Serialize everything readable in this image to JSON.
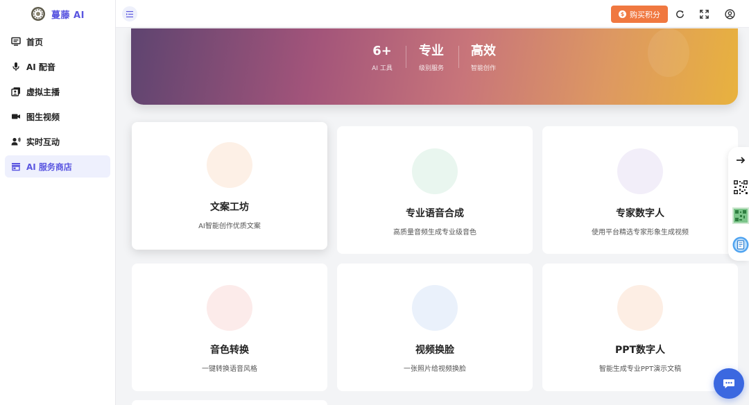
{
  "brand": {
    "name": "蔓藤 AI"
  },
  "sidebar": {
    "items": [
      {
        "label": "首页",
        "icon": "monitor-icon"
      },
      {
        "label": "AI 配音",
        "icon": "microphone-icon"
      },
      {
        "label": "虚拟主播",
        "icon": "gallery-icon"
      },
      {
        "label": "图生视频",
        "icon": "video-camera-icon"
      },
      {
        "label": "实时互动",
        "icon": "user-voice-icon"
      },
      {
        "label": "AI 服务商店",
        "icon": "store-icon"
      }
    ],
    "active_index": 5
  },
  "header": {
    "buy_label": "购买积分",
    "buy_color": "#f07840"
  },
  "banner": {
    "stats": [
      {
        "value": "6+",
        "label": "AI 工具"
      },
      {
        "value": "专业",
        "label": "级别服务"
      },
      {
        "value": "高效",
        "label": "智能创作"
      }
    ]
  },
  "cards": [
    {
      "title": "文案工坊",
      "desc": "AI智能创作优质文案",
      "circle_color": "#fdf0e6"
    },
    {
      "title": "专业语音合成",
      "desc": "高质量音频生成专业级音色",
      "circle_color": "#e9f6ef"
    },
    {
      "title": "专家数字人",
      "desc": "使用平台精选专家形象生成视频",
      "circle_color": "#f2eef9"
    },
    {
      "title": "音色转换",
      "desc": "一键转换语音风格",
      "circle_color": "#fcebea"
    },
    {
      "title": "视频换脸",
      "desc": "一张照片给视频换脸",
      "circle_color": "#eaf1fb"
    },
    {
      "title": "PPT数字人",
      "desc": "智能生成专业PPT演示文稿",
      "circle_color": "#fdeee4"
    }
  ],
  "colors": {
    "accent": "#5a56e0",
    "chat": "#3b68e0"
  }
}
